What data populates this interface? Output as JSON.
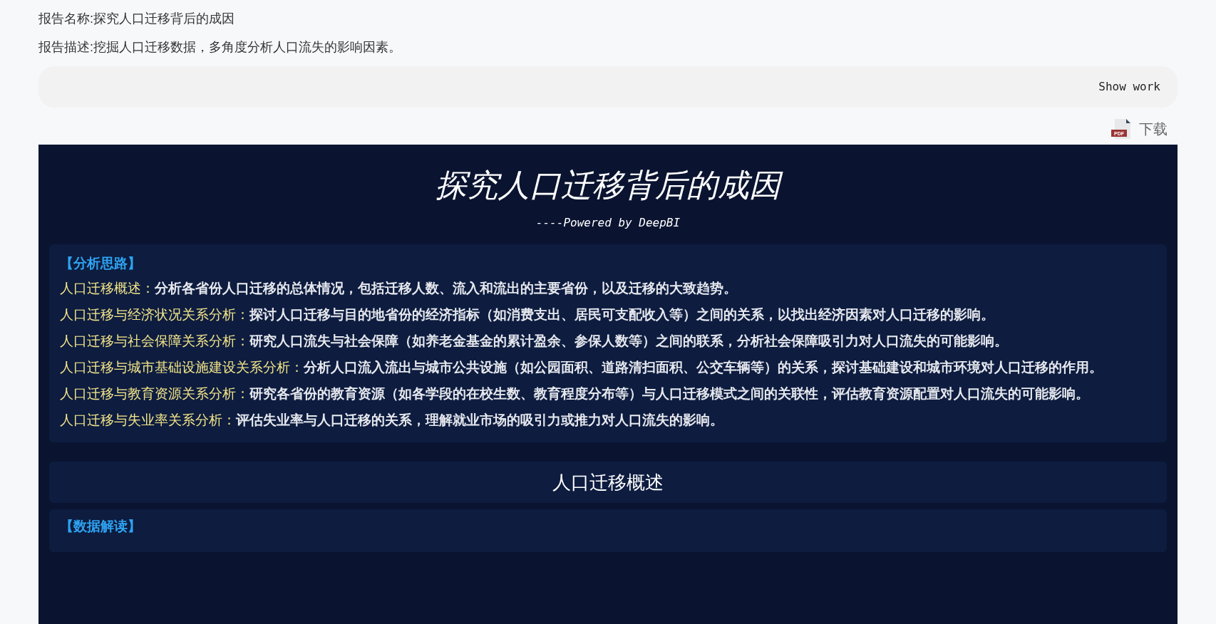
{
  "report_name": "报告名称:探究人口迁移背后的成因",
  "report_description": "报告描述:挖掘人口迁移数据，多角度分析人口流失的影响因素。",
  "show_work": {
    "label": "Show work"
  },
  "download": {
    "label": "下载",
    "file_type": "PDF"
  },
  "report": {
    "title": "探究人口迁移背后的成因",
    "subtitle": "----Powered by DeepBI",
    "analysis": {
      "heading": "【分析思路】",
      "items": [
        {
          "label": "人口迁移概述：",
          "text": "分析各省份人口迁移的总体情况，包括迁移人数、流入和流出的主要省份，以及迁移的大致趋势。"
        },
        {
          "label": "人口迁移与经济状况关系分析：",
          "text": "探讨人口迁移与目的地省份的经济指标（如消费支出、居民可支配收入等）之间的关系，以找出经济因素对人口迁移的影响。"
        },
        {
          "label": "人口迁移与社会保障关系分析：",
          "text": "研究人口流失与社会保障（如养老金基金的累计盈余、参保人数等）之间的联系，分析社会保障吸引力对人口流失的可能影响。"
        },
        {
          "label": "人口迁移与城市基础设施建设关系分析：",
          "text": "分析人口流入流出与城市公共设施（如公园面积、道路清扫面积、公交车辆等）的关系，探讨基础建设和城市环境对人口迁移的作用。"
        },
        {
          "label": "人口迁移与教育资源关系分析：",
          "text": "研究各省份的教育资源（如各学段的在校生数、教育程度分布等）与人口迁移模式之间的关联性，评估教育资源配置对人口流失的可能影响。"
        },
        {
          "label": "人口迁移与失业率关系分析：",
          "text": "评估失业率与人口迁移的关系，理解就业市场的吸引力或推力对人口流失的影响。"
        }
      ]
    },
    "section_title": "人口迁移概述",
    "next_heading": "【数据解读】"
  }
}
